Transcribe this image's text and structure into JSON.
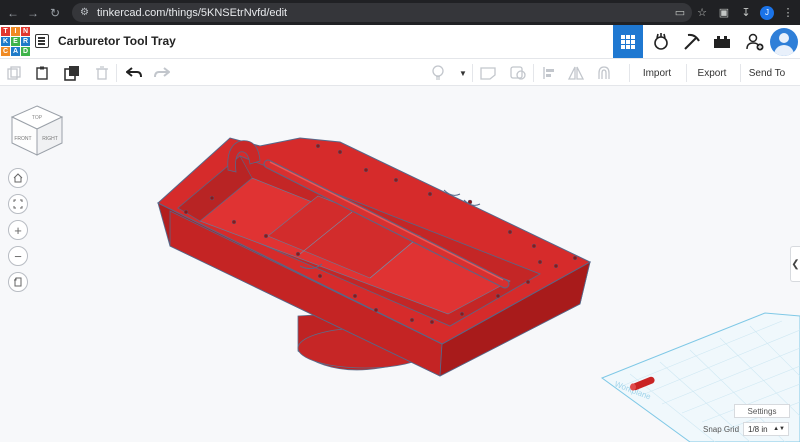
{
  "browser": {
    "url": "tinkercad.com/things/5KNSEtrNvfd/edit",
    "profile_initial": "J"
  },
  "logo": {
    "letters": [
      "T",
      "I",
      "N",
      "K",
      "E",
      "R",
      "C",
      "A",
      "D"
    ]
  },
  "header": {
    "title": "Carburetor Tool Tray"
  },
  "toolbar": {
    "import_label": "Import",
    "export_label": "Export",
    "send_to_label": "Send To"
  },
  "viewcube": {
    "top_label": "TOP",
    "front_label": "FRONT",
    "right_label": "RIGHT"
  },
  "workplane": {
    "label": "Workplane"
  },
  "bottom": {
    "settings_label": "Settings",
    "snap_grid_label": "Snap Grid",
    "snap_grid_value": "1/8 in"
  },
  "colors": {
    "model_red": "#d42b2b",
    "accent_blue": "#1f78d1",
    "browser_dark": "#202124"
  }
}
